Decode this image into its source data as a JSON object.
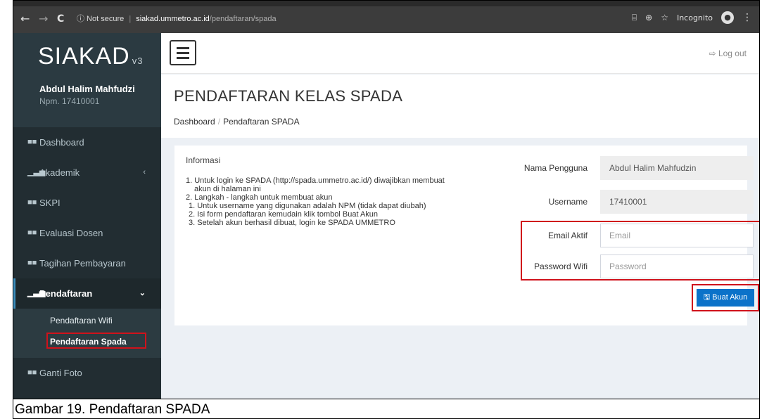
{
  "browser": {
    "back": "←",
    "forward": "→",
    "reload": "C",
    "security": "ⓘ Not secure",
    "divider": "|",
    "host": "siakad.ummetro.ac.id",
    "path": "/pendaftaran/spada",
    "incognito_label": "Incognito",
    "menu": "⋮"
  },
  "sidebar": {
    "brand": "SIAKAD",
    "version": "v3",
    "user_name": "Abdul Halim Mahfudzi",
    "user_npm": "Npm. 17410001",
    "items": [
      {
        "label": "Dashboard"
      },
      {
        "label": "Akademik",
        "caret": "‹"
      },
      {
        "label": "SKPI"
      },
      {
        "label": "Evaluasi Dosen"
      },
      {
        "label": "Tagihan Pembayaran"
      },
      {
        "label": "Pendaftaran",
        "caret": "⌄"
      },
      {
        "label": "Ganti Foto"
      }
    ],
    "submenu": [
      {
        "label": "Pendaftaran Wifi"
      },
      {
        "label": "Pendaftaran Spada"
      }
    ]
  },
  "header": {
    "logout": "Log out"
  },
  "page": {
    "title": "PENDAFTARAN KELAS SPADA",
    "breadcrumb_home": "Dashboard",
    "breadcrumb_sep": "/",
    "breadcrumb_current": "Pendaftaran SPADA"
  },
  "info": {
    "title": "Informasi",
    "lines": [
      "1. Untuk login ke SPADA (http://spada.ummetro.ac.id/) diwajibkan membuat",
      "    akun di halaman ini",
      "2. Langkah - langkah untuk membuat akun",
      "   1. Untuk username yang digunakan adalah NPM (tidak dapat diubah)",
      "   2. Isi form pendaftaran kemudain klik tombol Buat Akun",
      "   3. Setelah akun berhasil dibuat, login ke SPADA UMMETRO"
    ]
  },
  "form": {
    "nama_label": "Nama Pengguna",
    "nama_value": "Abdul Halim Mahfudzin",
    "username_label": "Username",
    "username_value": "17410001",
    "email_label": "Email Aktif",
    "email_placeholder": "Email",
    "password_label": "Password Wifi",
    "password_placeholder": "Password",
    "submit_label": "Buat Akun"
  },
  "caption": "Gambar 19. Pendaftaran SPADA",
  "colors": {
    "sidebar_bg": "#222d32",
    "brand_bg": "#2b3a41",
    "button_blue": "#0b72c9",
    "highlight_red": "#d0121b"
  }
}
